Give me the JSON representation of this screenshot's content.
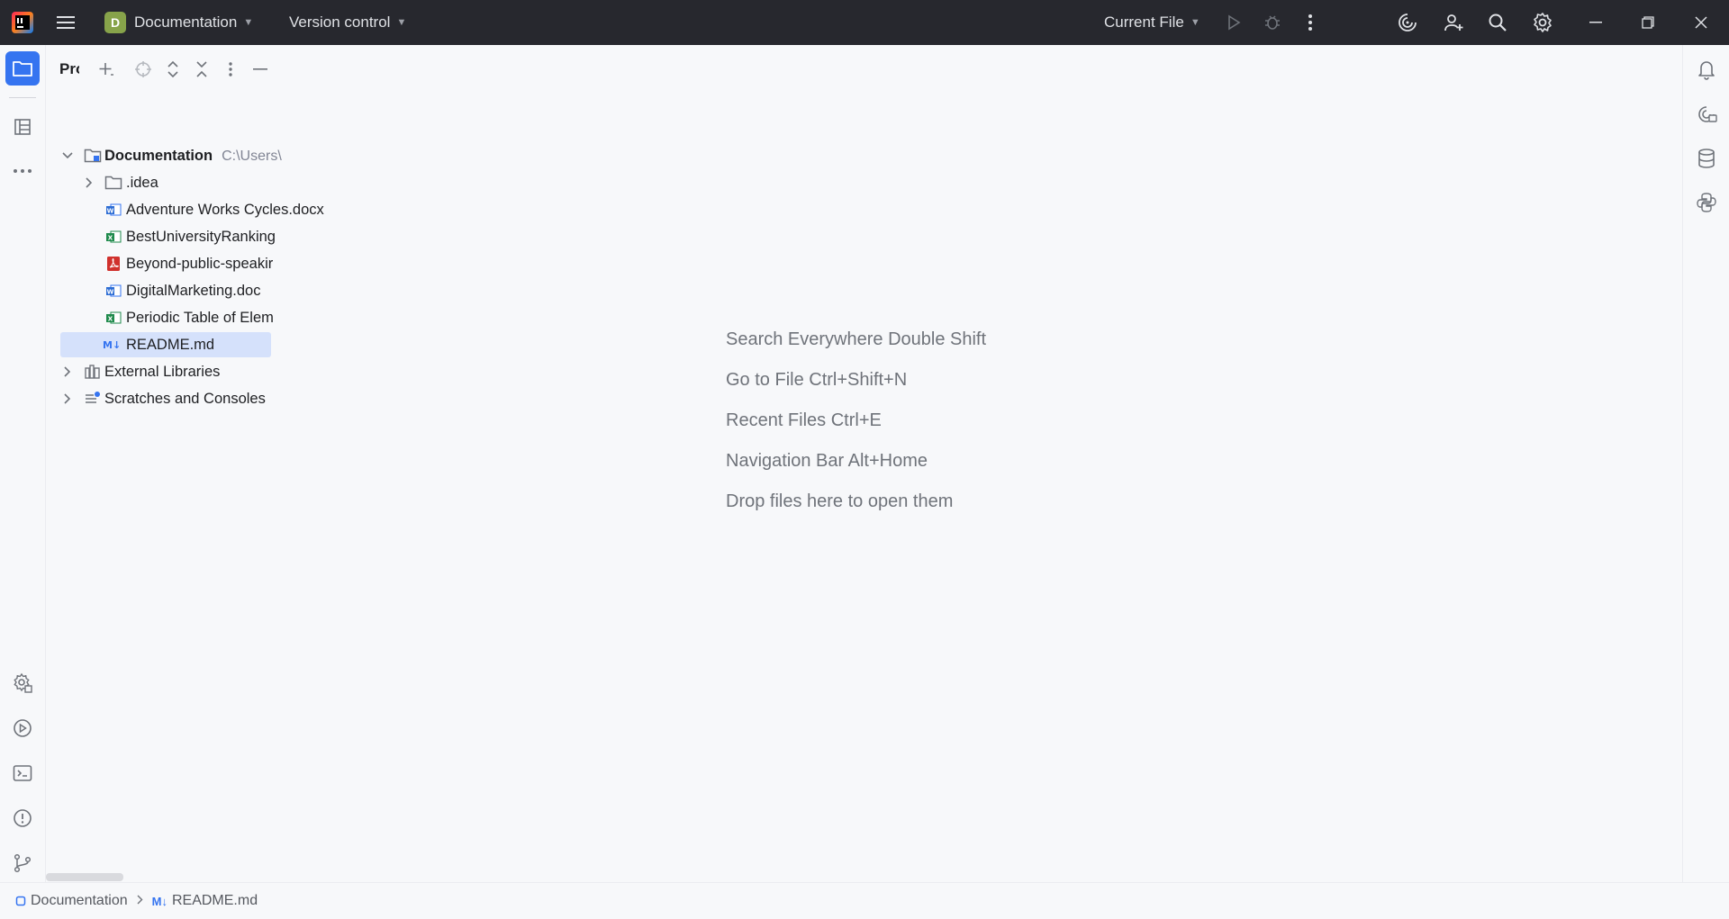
{
  "titlebar": {
    "project_initial": "D",
    "project_name": "Documentation",
    "vcs_label": "Version control",
    "run_config": "Current File",
    "colors": {
      "bg": "#27282e",
      "project_badge": "#87a34a"
    }
  },
  "project_panel": {
    "title": "Project",
    "root": {
      "name": "Documentation",
      "path": "C:\\Users\\"
    },
    "items": [
      {
        "label": ".idea",
        "type": "folder"
      },
      {
        "label": "Adventure Works Cycles.docx",
        "type": "word"
      },
      {
        "label": "BestUniversityRanking",
        "type": "excel"
      },
      {
        "label": "Beyond-public-speakir",
        "type": "pdf"
      },
      {
        "label": "DigitalMarketing.doc",
        "type": "word"
      },
      {
        "label": "Periodic Table of Elem",
        "type": "excel"
      },
      {
        "label": "README.md",
        "type": "markdown",
        "selected": true
      }
    ],
    "external_libraries": "External Libraries",
    "scratches": "Scratches and Consoles"
  },
  "editor": {
    "hints": [
      "Search Everywhere Double Shift",
      "Go to File Ctrl+Shift+N",
      "Recent Files Ctrl+E",
      "Navigation Bar Alt+Home",
      "Drop files here to open them"
    ]
  },
  "statusbar": {
    "crumb_project": "Documentation",
    "crumb_file": "README.md",
    "md_icon_text": "M↓"
  }
}
